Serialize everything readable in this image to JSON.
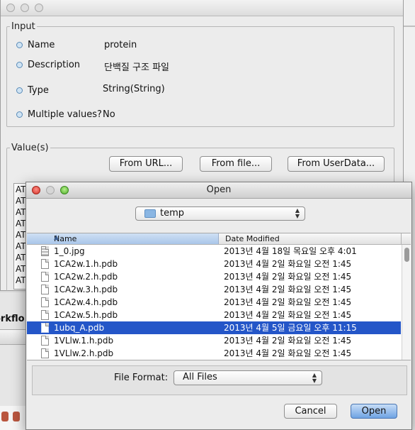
{
  "input_group": {
    "legend": "Input",
    "rows": [
      {
        "label": "Name",
        "value": "protein"
      },
      {
        "label": "Description",
        "value": "단백질 구조 파일"
      },
      {
        "label": "Type",
        "value": "String(String)"
      },
      {
        "label": "Multiple values?",
        "value": "No"
      }
    ]
  },
  "values_group": {
    "legend": "Value(s)",
    "buttons": [
      "From URL...",
      "From file...",
      "From UserData..."
    ],
    "list_items": [
      "AT",
      "AT",
      "AT",
      "AT",
      "AT",
      "AT",
      "AT",
      "AT",
      "AT"
    ]
  },
  "background_window": {
    "workflow_fragment": "orkflo"
  },
  "open_dialog": {
    "title": "Open",
    "folder": "temp",
    "columns": {
      "name": "Name",
      "date": "Date Modified"
    },
    "files": [
      {
        "name": "1_0.jpg",
        "date": "2013년 4월 18일 목요일 오후 4:01",
        "icon": "image-file-icon",
        "selected": false
      },
      {
        "name": "1CA2w.1.h.pdb",
        "date": "2013년 4월 2일 화요일 오전 1:45",
        "icon": "document-icon",
        "selected": false
      },
      {
        "name": "1CA2w.2.h.pdb",
        "date": "2013년 4월 2일 화요일 오전 1:45",
        "icon": "document-icon",
        "selected": false
      },
      {
        "name": "1CA2w.3.h.pdb",
        "date": "2013년 4월 2일 화요일 오전 1:45",
        "icon": "document-icon",
        "selected": false
      },
      {
        "name": "1CA2w.4.h.pdb",
        "date": "2013년 4월 2일 화요일 오전 1:45",
        "icon": "document-icon",
        "selected": false
      },
      {
        "name": "1CA2w.5.h.pdb",
        "date": "2013년 4월 2일 화요일 오전 1:45",
        "icon": "document-icon",
        "selected": false
      },
      {
        "name": "1ubq_A.pdb",
        "date": "2013년 4월 5일 금요일 오후 11:15",
        "icon": "document-icon",
        "selected": true
      },
      {
        "name": "1VLlw.1.h.pdb",
        "date": "2013년 4월 2일 화요일 오전 1:45",
        "icon": "document-icon",
        "selected": false
      },
      {
        "name": "1VLlw.2.h.pdb",
        "date": "2013년 4월 2일 화요일 오전 1:45",
        "icon": "document-icon",
        "selected": false
      }
    ],
    "file_format_label": "File Format:",
    "file_format_value": "All Files",
    "cancel_label": "Cancel",
    "open_label": "Open"
  },
  "colors": {
    "selection": "#2456c8",
    "accent": "#6fa3e3"
  }
}
